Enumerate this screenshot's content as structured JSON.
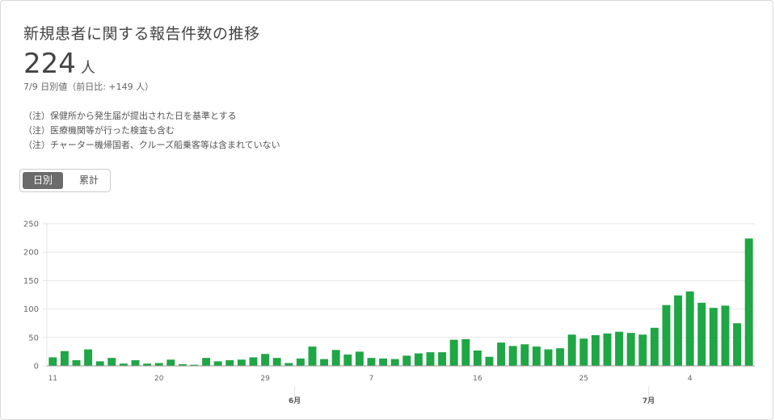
{
  "header": {
    "title": "新規患者に関する報告件数の推移",
    "value": "224",
    "value_unit": "人",
    "subtext": "7/9 日別値（前日比: +149 人）"
  },
  "notes": [
    "（注）保健所から発生届が提出された日を基準とする",
    "（注）医療機関等が行った検査も含む",
    "（注）チャーター機帰国者、クルーズ船乗客等は含まれていない"
  ],
  "toggle": {
    "daily_label": "日別",
    "cumulative_label": "累計",
    "selected": "日別"
  },
  "colors": {
    "bar": "#1fa645",
    "grid": "#e5e5e5",
    "axis": "#9a9a9a"
  },
  "chart_data": {
    "type": "bar",
    "ylim": [
      0,
      250
    ],
    "yticks": [
      0,
      50,
      100,
      150,
      200,
      250
    ],
    "x": [
      "5/11",
      "5/12",
      "5/13",
      "5/14",
      "5/15",
      "5/16",
      "5/17",
      "5/18",
      "5/19",
      "5/20",
      "5/21",
      "5/22",
      "5/23",
      "5/24",
      "5/25",
      "5/26",
      "5/27",
      "5/28",
      "5/29",
      "5/30",
      "5/31",
      "6/1",
      "6/2",
      "6/3",
      "6/4",
      "6/5",
      "6/6",
      "6/7",
      "6/8",
      "6/9",
      "6/10",
      "6/11",
      "6/12",
      "6/13",
      "6/14",
      "6/15",
      "6/16",
      "6/17",
      "6/18",
      "6/19",
      "6/20",
      "6/21",
      "6/22",
      "6/23",
      "6/24",
      "6/25",
      "6/26",
      "6/27",
      "6/28",
      "6/29",
      "6/30",
      "7/1",
      "7/2",
      "7/3",
      "7/4",
      "7/5",
      "7/6",
      "7/7",
      "7/8",
      "7/9"
    ],
    "values": [
      15,
      26,
      10,
      29,
      8,
      14,
      4,
      10,
      4,
      5,
      11,
      3,
      2,
      14,
      8,
      10,
      11,
      15,
      21,
      14,
      5,
      13,
      34,
      12,
      28,
      20,
      25,
      14,
      13,
      12,
      18,
      22,
      24,
      24,
      46,
      47,
      27,
      16,
      41,
      35,
      38,
      34,
      29,
      31,
      55,
      48,
      54,
      57,
      60,
      58,
      55,
      67,
      107,
      124,
      131,
      111,
      102,
      106,
      75,
      224
    ],
    "x_tick_labels": [
      {
        "index": 0,
        "label": "11"
      },
      {
        "index": 9,
        "label": "20"
      },
      {
        "index": 18,
        "label": "29"
      },
      {
        "index": 27,
        "label": "7"
      },
      {
        "index": 36,
        "label": "16"
      },
      {
        "index": 45,
        "label": "25"
      },
      {
        "index": 54,
        "label": "4"
      }
    ],
    "month_labels": [
      {
        "index": 21,
        "label": "6月"
      },
      {
        "index": 51,
        "label": "7月"
      }
    ],
    "grid": true,
    "legend": "none"
  }
}
